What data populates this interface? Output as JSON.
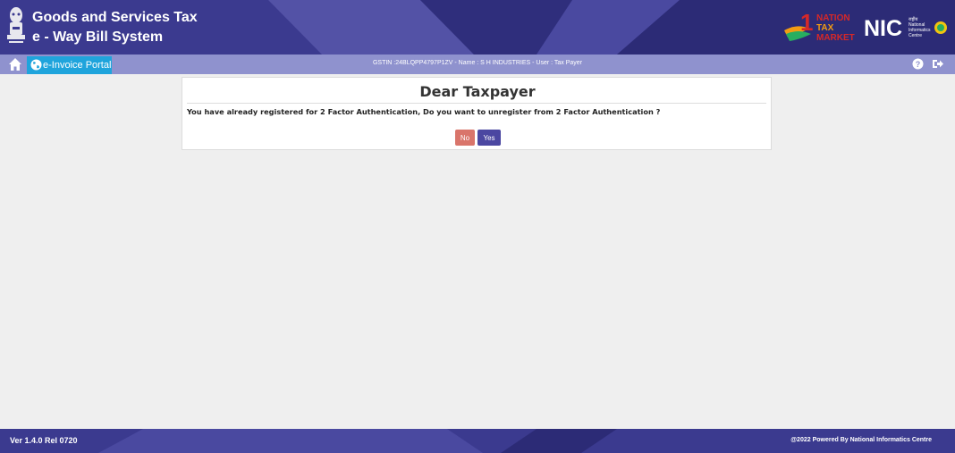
{
  "header": {
    "title_line1": "Goods and Services Tax",
    "title_line2": "e - Way Bill System",
    "logo_ntm_line1": "NATION",
    "logo_ntm_line2": "TAX",
    "logo_ntm_line3": "MARKET",
    "logo_nic_text": "NIC",
    "logo_nic_sub1": "राष्ट्रीय",
    "logo_nic_sub2": "National",
    "logo_nic_sub3": "Informatics",
    "logo_nic_sub4": "Centre"
  },
  "navbar": {
    "portal_label": "e-Invoice Portal",
    "gstin_text": "GSTIN :24BLQPP4797P1ZV - Name : S H INDUSTRIES - User : Tax Payer"
  },
  "dialog": {
    "title": "Dear Taxpayer",
    "message": "You have already registered for 2 Factor Authentication, Do you want to unregister from 2 Factor Authentication ?",
    "no_label": "No",
    "yes_label": "Yes"
  },
  "footer": {
    "version": "Ver 1.4.0 Rel 0720",
    "powered_by": "@2022 Powered By National Informatics Centre"
  },
  "colors": {
    "header_bg": "#3b3a8f",
    "navbar_bg": "#8f92ce",
    "portal_tab": "#1fa4dc",
    "no_button": "#d9756b",
    "yes_button": "#4b47a1"
  },
  "icons": {
    "home": "home-icon",
    "globe": "globe-icon",
    "help": "help-icon",
    "logout": "logout-icon",
    "emblem": "emblem-icon"
  }
}
